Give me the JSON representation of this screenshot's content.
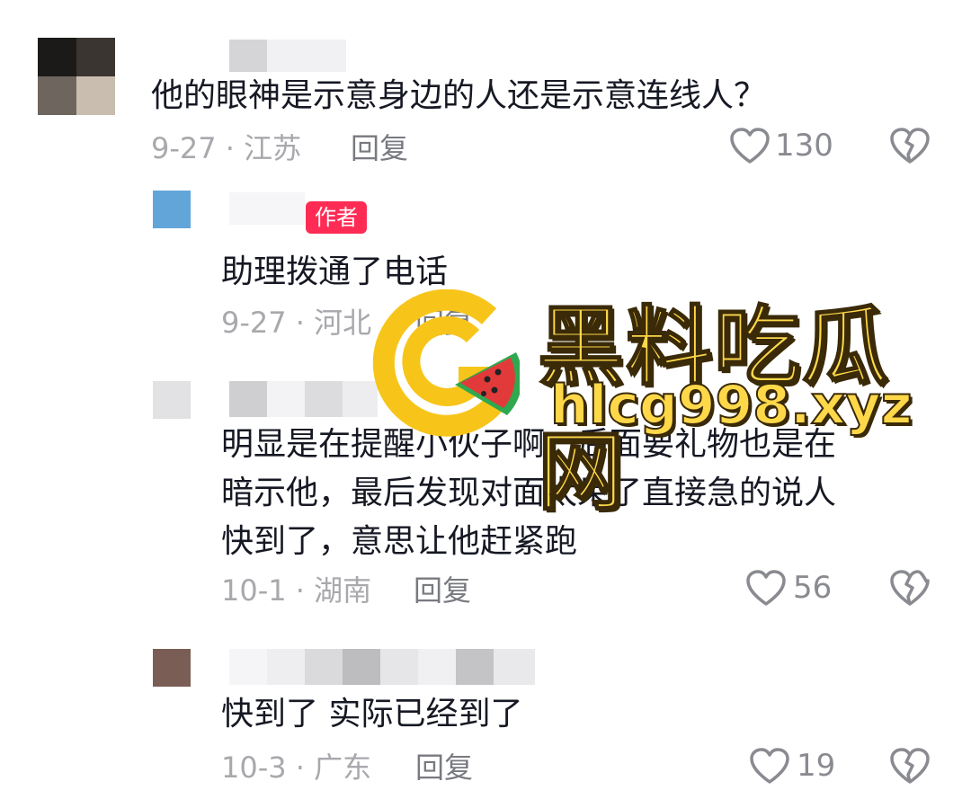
{
  "comments": [
    {
      "text_lines": [
        "他的眼神是示意身边的人还是示意连线人？"
      ],
      "meta": "9-27 · 江苏",
      "reply_label": "回复",
      "like_count": "130"
    },
    {
      "badge": "作者",
      "text_lines": [
        "助理拨通了电话"
      ],
      "meta": "9-27 · 河北",
      "reply_label": "回复"
    },
    {
      "text_lines": [
        "明显是在提醒小伙子啊，后面要礼物也是在",
        "暗示他，最后发现对面太呆了直接急的说人",
        "快到了，意思让他赶紧跑"
      ],
      "meta": "10-1 · 湖南",
      "reply_label": "回复",
      "like_count": "56"
    },
    {
      "text_lines": [
        "快到了 实际已经到了"
      ],
      "meta": "10-3 · 广东",
      "reply_label": "回复",
      "like_count": "19"
    }
  ],
  "watermark": {
    "title": "黑料吃瓜网",
    "url": "hlcg998.xyz"
  },
  "icons": {
    "like": "heart-outline-icon",
    "dislike": "broken-heart-icon"
  },
  "colors": {
    "text": "#161823",
    "meta": "#a8a8ad",
    "author_badge": "#fe2c55",
    "watermark": "#ffd84a"
  }
}
